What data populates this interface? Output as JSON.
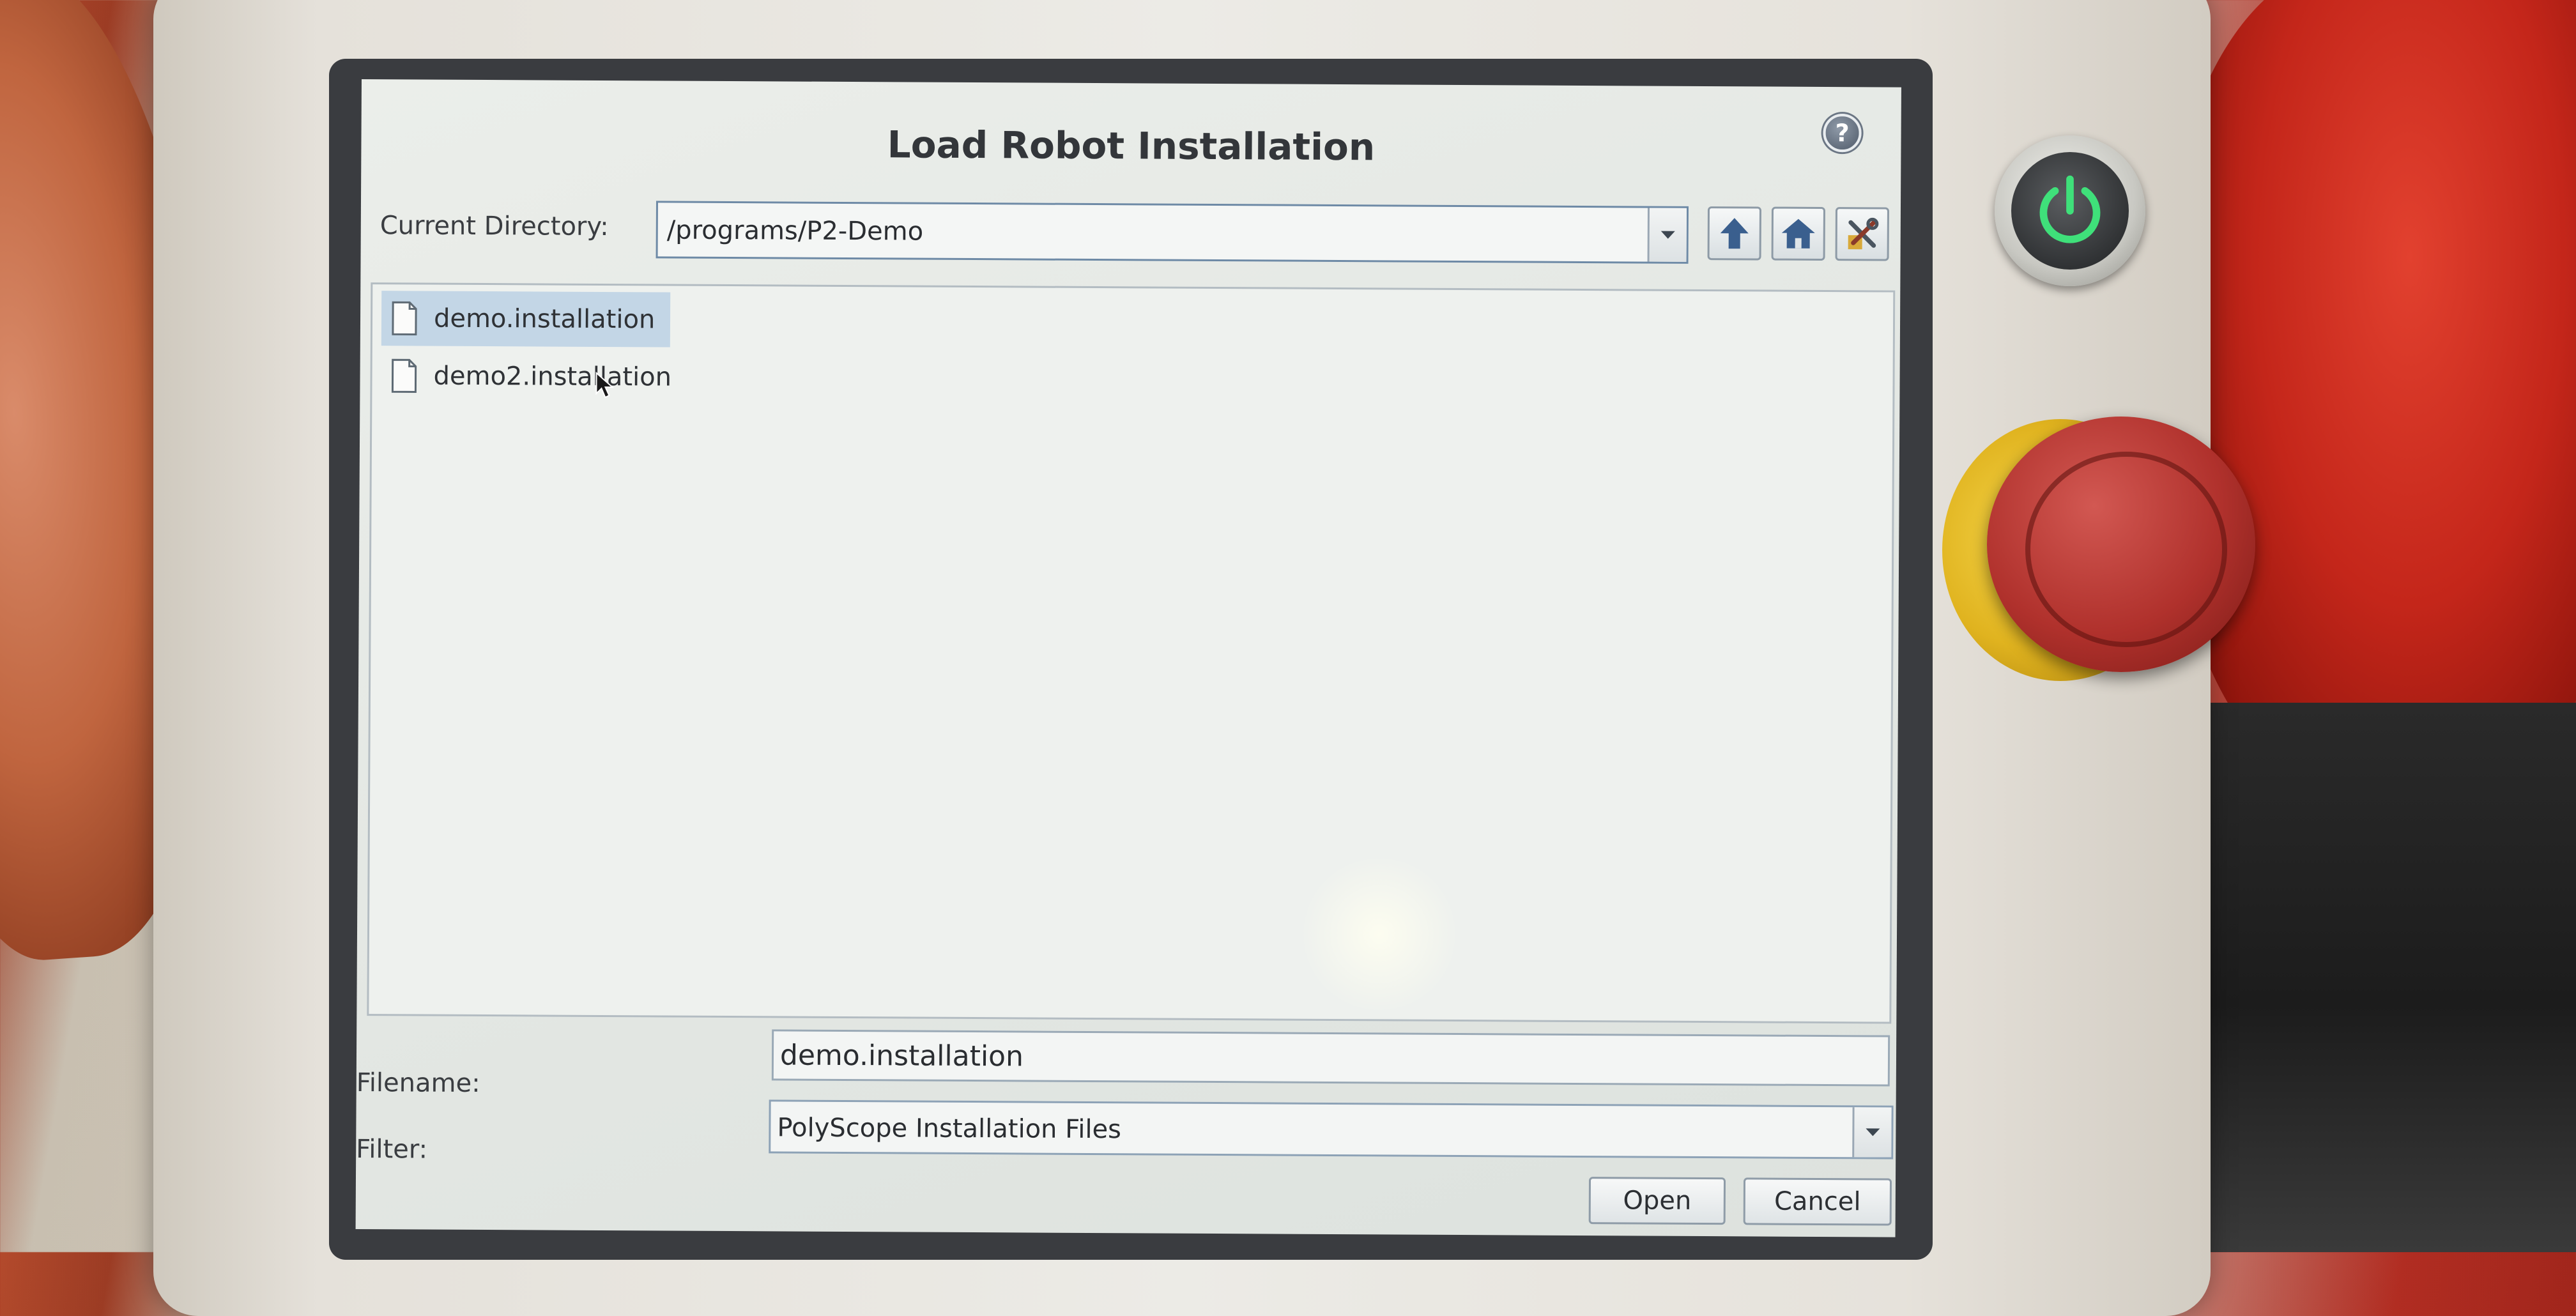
{
  "dialog": {
    "title": "Load Robot Installation",
    "help_icon": "?"
  },
  "current_directory": {
    "label": "Current Directory:",
    "value": "/programs/P2-Demo"
  },
  "toolbar": {
    "icons": [
      "arrow-up-icon",
      "home-icon",
      "tools-icon"
    ]
  },
  "files": [
    {
      "name": "demo.installation",
      "selected": true
    },
    {
      "name": "demo2.installation",
      "selected": false
    }
  ],
  "filename": {
    "label": "Filename:",
    "value": "demo.installation"
  },
  "filter": {
    "label": "Filter:",
    "value": "PolyScope Installation Files"
  },
  "buttons": {
    "open": "Open",
    "cancel": "Cancel"
  },
  "colors": {
    "selection": "#c3d6e6",
    "accent": "#4a7bb0",
    "power_led": "#3fe07a"
  }
}
